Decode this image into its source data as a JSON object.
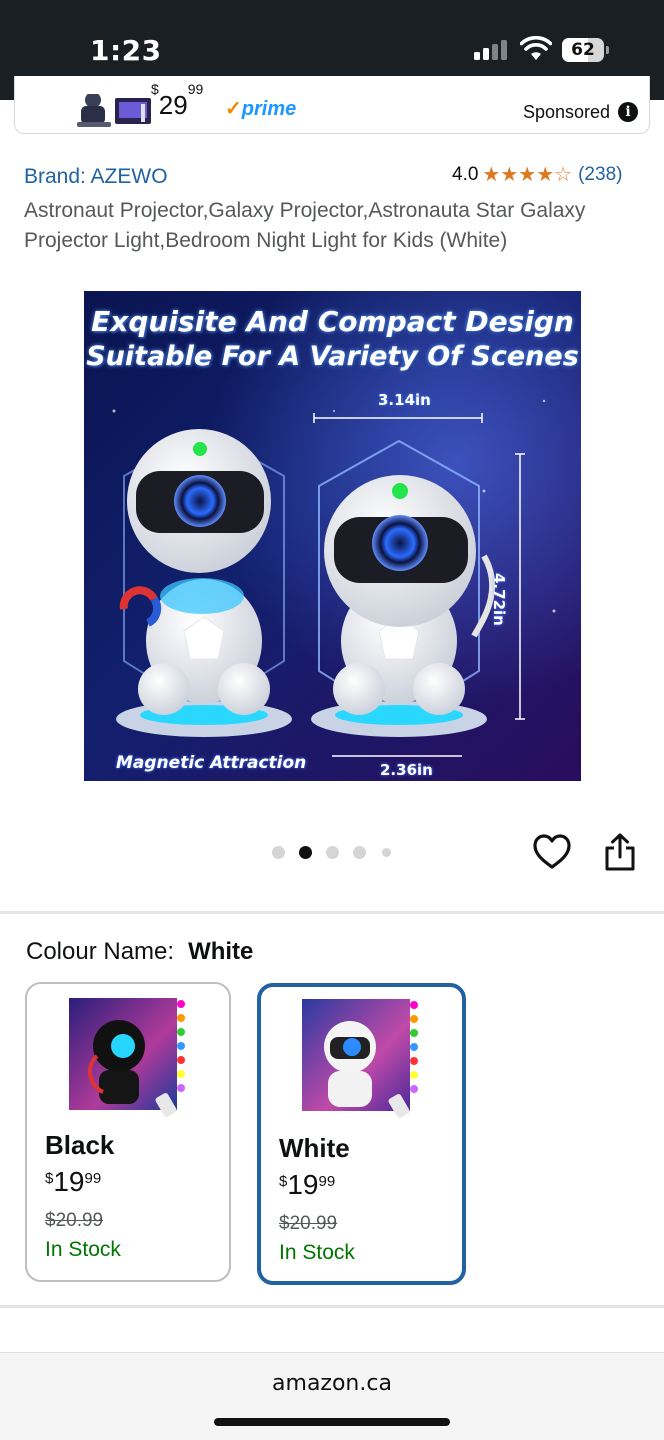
{
  "status_bar": {
    "time": "1:23",
    "battery": "62",
    "battery_level": 0.62
  },
  "sponsored_ad": {
    "price_symbol": "$",
    "price_whole": "29",
    "price_fraction": "99",
    "prime": "prime",
    "sponsored_label": "Sponsored",
    "info_icon": "info-icon"
  },
  "product": {
    "brand": "Brand: AZEWO",
    "rating": "4.0",
    "stars": 4,
    "rating_count": "(238)",
    "title": "Astronaut Projector,Galaxy Projector,Astronauta Star Galaxy Projector Light,Bedroom Night Light for Kids (White)"
  },
  "image": {
    "headline_1": "Exquisite And Compact Design",
    "headline_2": "Suitable For A Variety Of Scenes",
    "width_label": "3.14in",
    "height_label": "4.72in",
    "base_label": "2.36in",
    "magnetic_label": "Magnetic Attraction"
  },
  "carousel": {
    "count": 5,
    "active": 1
  },
  "actions": {
    "wishlist_icon": "heart-icon",
    "share_icon": "share-icon"
  },
  "variation": {
    "label": "Colour Name:",
    "selected": "White",
    "options": [
      {
        "name": "Black",
        "currency": "$",
        "whole": "19",
        "fraction": "99",
        "was": "$20.99",
        "stock": "In Stock"
      },
      {
        "name": "White",
        "currency": "$",
        "whole": "19",
        "fraction": "99",
        "was": "$20.99",
        "stock": "In Stock"
      }
    ]
  },
  "browser": {
    "url": "amazon.ca"
  },
  "colors": {
    "link": "#2162a1",
    "star": "#de7921",
    "in_stock": "#007600",
    "selected_border": "#2162a1",
    "status_bar": "#1a1f24"
  }
}
